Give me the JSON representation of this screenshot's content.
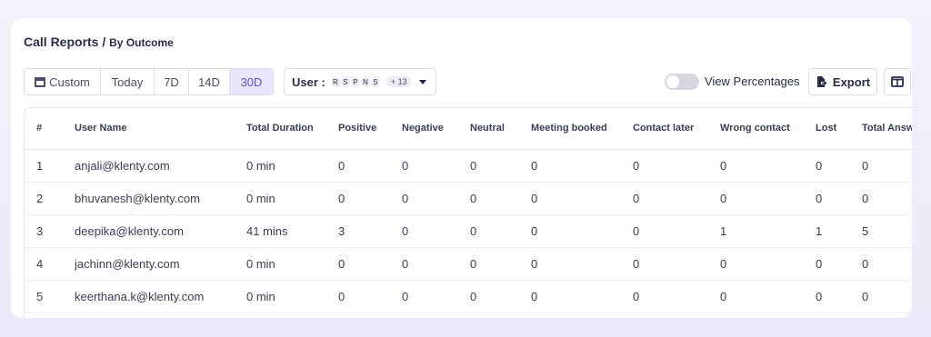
{
  "header": {
    "title": "Call Reports",
    "separator": " / ",
    "subtitle": "By Outcome"
  },
  "range": {
    "custom": "Custom",
    "today": "Today",
    "d7": "7D",
    "d14": "14D",
    "d30": "30D",
    "selected": "30D"
  },
  "user_filter": {
    "label": "User :",
    "avatars": [
      "R",
      "S",
      "P",
      "N",
      "S"
    ],
    "more": "+ 13"
  },
  "toolbar": {
    "view_percentages": "View Percentages",
    "view_percentages_on": false,
    "export": "Export"
  },
  "table": {
    "columns": [
      "#",
      "User Name",
      "Total Duration",
      "Positive",
      "Negative",
      "Neutral",
      "Meeting booked",
      "Contact later",
      "Wrong contact",
      "Lost",
      "Total Answ"
    ],
    "rows": [
      [
        "1",
        "anjali@klenty.com",
        "0 min",
        "0",
        "0",
        "0",
        "0",
        "0",
        "0",
        "0",
        "0"
      ],
      [
        "2",
        "bhuvanesh@klenty.com",
        "0 min",
        "0",
        "0",
        "0",
        "0",
        "0",
        "0",
        "0",
        "0"
      ],
      [
        "3",
        "deepika@klenty.com",
        "41 mins",
        "3",
        "0",
        "0",
        "0",
        "0",
        "1",
        "1",
        "5"
      ],
      [
        "4",
        "jachinn@klenty.com",
        "0 min",
        "0",
        "0",
        "0",
        "0",
        "0",
        "0",
        "0",
        "0"
      ],
      [
        "5",
        "keerthana.k@klenty.com",
        "0 min",
        "0",
        "0",
        "0",
        "0",
        "0",
        "0",
        "0",
        "0"
      ]
    ]
  },
  "colors": {
    "accent": "#5b4fd6",
    "accent_bg": "#e9e6fb",
    "text": "#2a2d4a"
  }
}
